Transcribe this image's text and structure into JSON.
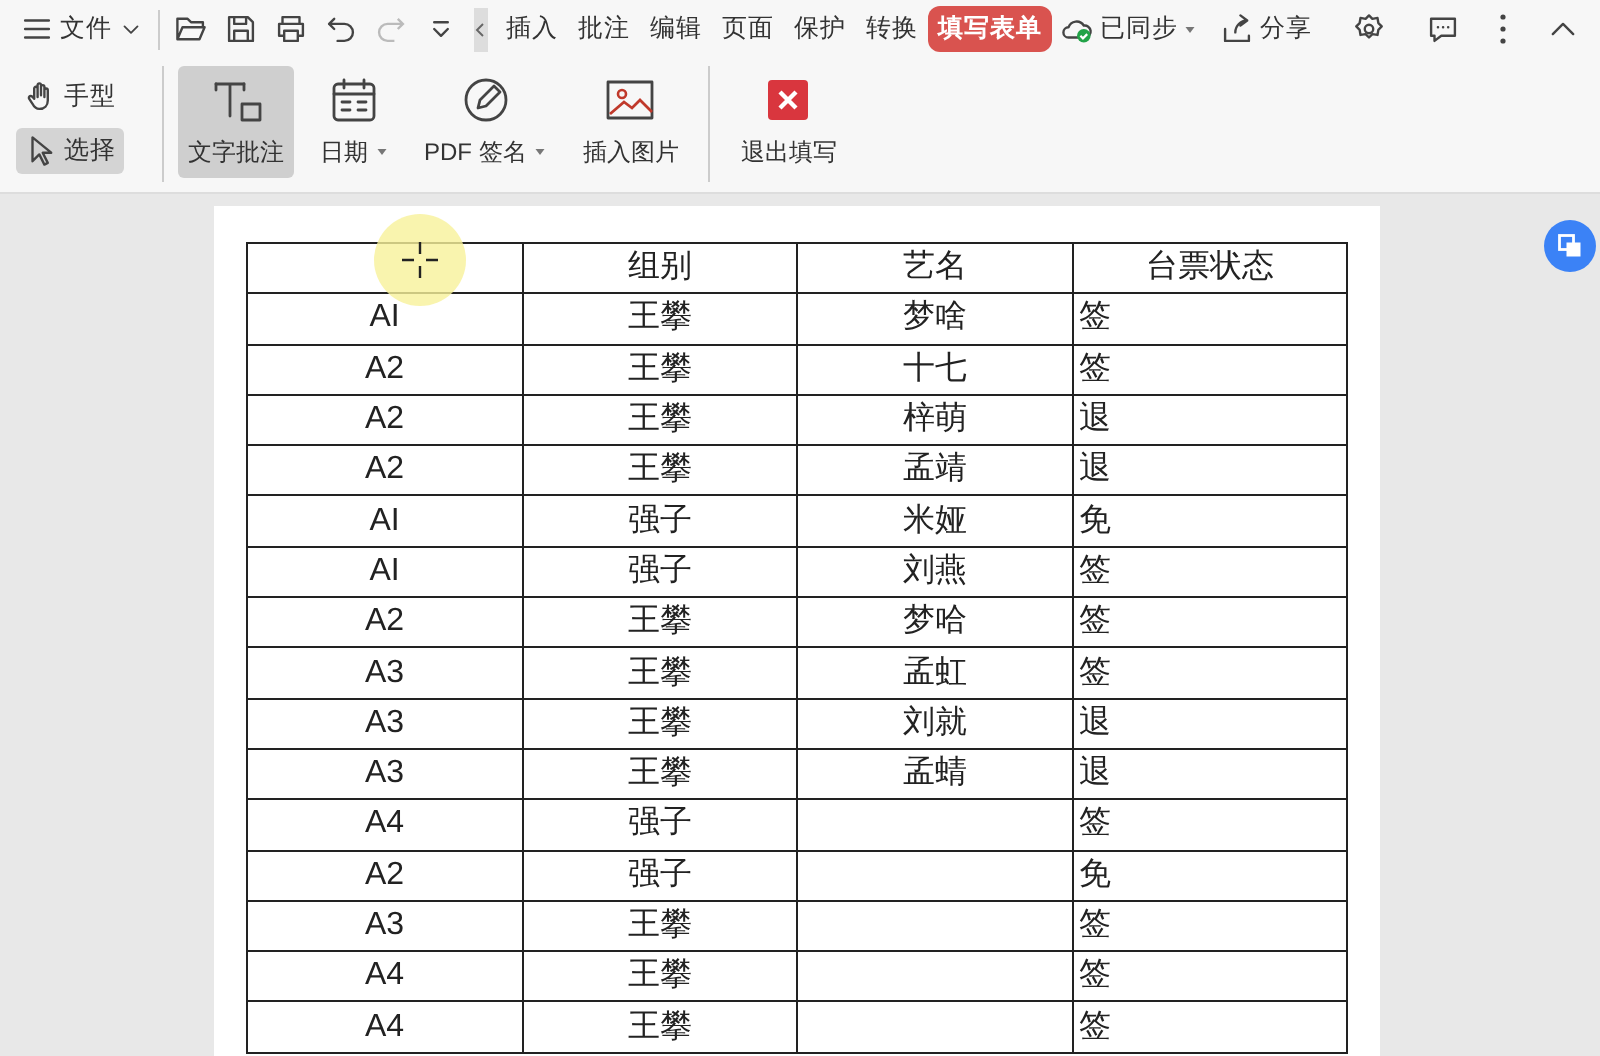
{
  "menu": {
    "file": "文件",
    "tabs": [
      {
        "label": "插入",
        "selected": false
      },
      {
        "label": "批注",
        "selected": false
      },
      {
        "label": "编辑",
        "selected": false
      },
      {
        "label": "页面",
        "selected": false
      },
      {
        "label": "保护",
        "selected": false
      },
      {
        "label": "转换",
        "selected": false
      },
      {
        "label": "填写表单",
        "selected": true
      }
    ],
    "sync": "已同步",
    "share": "分享"
  },
  "tools": [
    {
      "kind": "hand",
      "label": "手型",
      "selected": false
    },
    {
      "kind": "select",
      "label": "选择",
      "selected": true
    }
  ],
  "actions": [
    {
      "kind": "text",
      "label": "文字批注",
      "selected": true,
      "caret": false
    },
    {
      "kind": "date",
      "label": "日期",
      "selected": false,
      "caret": true
    },
    {
      "kind": "sign",
      "label": "PDF 签名",
      "selected": false,
      "caret": true
    },
    {
      "kind": "image",
      "label": "插入图片",
      "selected": false,
      "caret": false
    },
    {
      "kind": "exit",
      "label": "退出填写",
      "selected": false,
      "caret": false
    }
  ],
  "table": {
    "columns": [
      "组别",
      "艺名",
      "台票状态"
    ],
    "rows": [
      {
        "column_1": "AI",
        "group": "王攀",
        "name": "梦啥",
        "status": "签"
      },
      {
        "column_1": "A2",
        "group": "王攀",
        "name": "十七",
        "status": "签"
      },
      {
        "column_1": "A2",
        "group": "王攀",
        "name": "梓萌",
        "status": "退"
      },
      {
        "column_1": "A2",
        "group": "王攀",
        "name": "孟靖",
        "status": "退"
      },
      {
        "column_1": "AI",
        "group": "强子",
        "name": "米娅",
        "status": "免"
      },
      {
        "column_1": "AI",
        "group": "强子",
        "name": "刘燕",
        "status": "签"
      },
      {
        "column_1": "A2",
        "group": "王攀",
        "name": "梦哈",
        "status": "签"
      },
      {
        "column_1": "A3",
        "group": "王攀",
        "name": "孟虹",
        "status": "签"
      },
      {
        "column_1": "A3",
        "group": "王攀",
        "name": "刘就",
        "status": "退"
      },
      {
        "column_1": "A3",
        "group": "王攀",
        "name": "孟蜻",
        "status": "退"
      },
      {
        "column_1": "A4",
        "group": "强子",
        "status": "签"
      },
      {
        "column_1": "A2",
        "group": "强子",
        "status": "免"
      },
      {
        "column_1": "A3",
        "group": "王攀",
        "status": "签"
      },
      {
        "column_1": "A4",
        "group": "王攀",
        "status": "签"
      },
      {
        "column_1": "A4",
        "group": "王攀",
        "status": "签"
      }
    ]
  }
}
